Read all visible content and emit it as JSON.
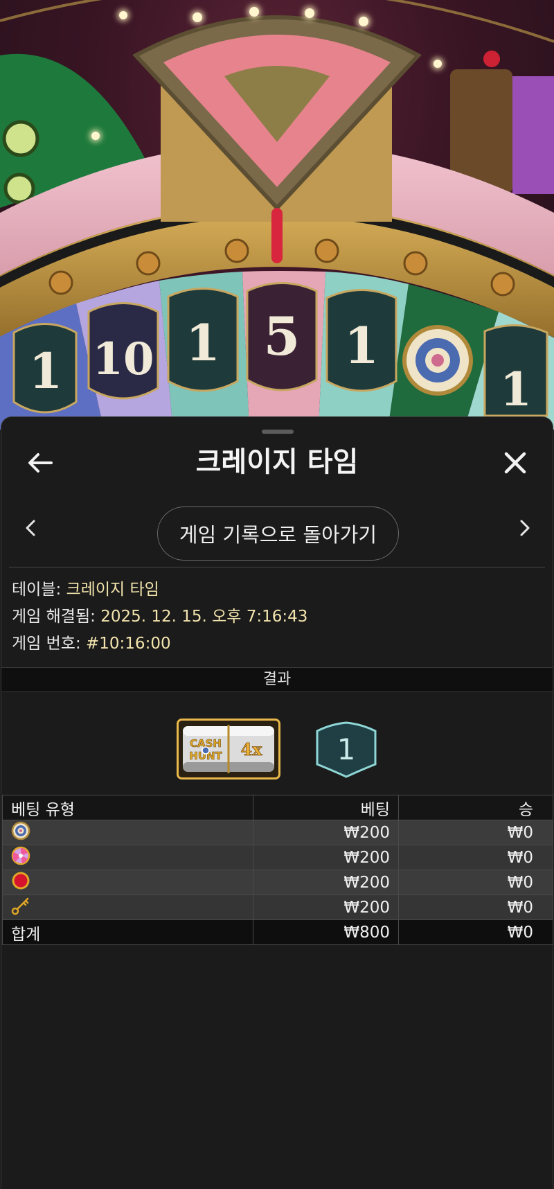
{
  "header": {
    "title": "크레이지 타임",
    "back_icon": "arrow-left-icon",
    "close_icon": "close-icon"
  },
  "navigation": {
    "back_to_history_label": "게임 기록으로 돌아가기",
    "prev_icon": "chevron-left-icon",
    "next_icon": "chevron-right-icon"
  },
  "info": {
    "table_label": "테이블:",
    "table_value": "크레이지 타임",
    "resolved_label": "게임 해결됨:",
    "resolved_value": "2025. 12. 15. 오후 7:16:43",
    "game_number_label": "게임 번호:",
    "game_number_value": "#10:16:00"
  },
  "result": {
    "heading": "결과",
    "top_slot": {
      "bonus_logo_text": [
        "CASH",
        "HUNT"
      ],
      "multiplier": "4x"
    },
    "wheel_result": "1"
  },
  "bets_table": {
    "headers": {
      "type": "베팅 유형",
      "bet": "베팅",
      "win": "승"
    },
    "rows": [
      {
        "icon": "cash-hunt-icon",
        "bet": "₩200",
        "win": "₩0"
      },
      {
        "icon": "pachinko-icon",
        "bet": "₩200",
        "win": "₩0"
      },
      {
        "icon": "coin-flip-icon",
        "bet": "₩200",
        "win": "₩0"
      },
      {
        "icon": "crazy-time-key-icon",
        "bet": "₩200",
        "win": "₩0"
      }
    ],
    "total": {
      "label": "합계",
      "bet": "₩800",
      "win": "₩0"
    }
  },
  "wheel_numbers": [
    "1",
    "10",
    "1",
    "5",
    "1",
    "1"
  ],
  "colors": {
    "sheet_background": "#1b1b1b",
    "value_text": "#f3e4ad",
    "result_tile_border": "#8fd6d6",
    "pointer_red": "#d7263d"
  }
}
